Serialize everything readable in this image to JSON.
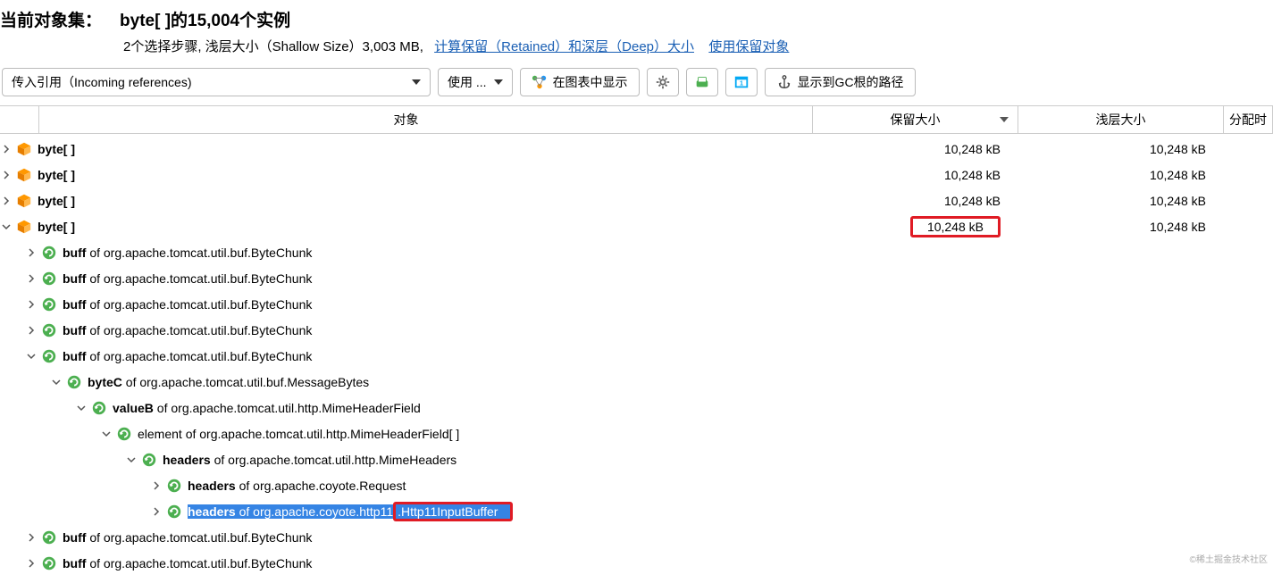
{
  "header": {
    "title_label": "当前对象集：",
    "title_value": "byte[ ]的15,004个实例",
    "subtitle_prefix": "2个选择步骤, 浅层大小（Shallow Size）3,003 MB,",
    "link1": "计算保留（Retained）和深层（Deep）大小",
    "link2": "使用保留对象"
  },
  "toolbar": {
    "incoming_refs": "传入引用（Incoming references)",
    "use_btn": "使用 ...",
    "show_in_graph": "在图表中显示",
    "gc_root_path": "显示到GC根的路径"
  },
  "columns": {
    "object": "对象",
    "retained": "保留大小",
    "shallow": "浅层大小",
    "alloc": "分配时"
  },
  "rows": [
    {
      "depth": 0,
      "exp": "right",
      "icon": "cube",
      "bold": "byte[ ]",
      "rest": "",
      "ret": "10,248 kB",
      "shal": "10,248 kB"
    },
    {
      "depth": 0,
      "exp": "right",
      "icon": "cube",
      "bold": "byte[ ]",
      "rest": "",
      "ret": "10,248 kB",
      "shal": "10,248 kB"
    },
    {
      "depth": 0,
      "exp": "right",
      "icon": "cube",
      "bold": "byte[ ]",
      "rest": "",
      "ret": "10,248 kB",
      "shal": "10,248 kB"
    },
    {
      "depth": 0,
      "exp": "down",
      "icon": "cube",
      "bold": "byte[ ]",
      "rest": "",
      "ret": "10,248 kB",
      "shal": "10,248 kB",
      "ret_boxed": true
    },
    {
      "depth": 1,
      "exp": "right",
      "icon": "ref",
      "bold": "buff",
      "rest": " of org.apache.tomcat.util.buf.ByteChunk"
    },
    {
      "depth": 1,
      "exp": "right",
      "icon": "ref",
      "bold": "buff",
      "rest": " of org.apache.tomcat.util.buf.ByteChunk"
    },
    {
      "depth": 1,
      "exp": "right",
      "icon": "ref",
      "bold": "buff",
      "rest": " of org.apache.tomcat.util.buf.ByteChunk"
    },
    {
      "depth": 1,
      "exp": "right",
      "icon": "ref",
      "bold": "buff",
      "rest": " of org.apache.tomcat.util.buf.ByteChunk"
    },
    {
      "depth": 1,
      "exp": "down",
      "icon": "ref",
      "bold": "buff",
      "rest": " of org.apache.tomcat.util.buf.ByteChunk"
    },
    {
      "depth": 2,
      "exp": "down",
      "icon": "ref",
      "bold": "byteC",
      "rest": " of org.apache.tomcat.util.buf.MessageBytes"
    },
    {
      "depth": 3,
      "exp": "down",
      "icon": "ref",
      "bold": "valueB",
      "rest": " of org.apache.tomcat.util.http.MimeHeaderField"
    },
    {
      "depth": 4,
      "exp": "down",
      "icon": "ref",
      "bold": "",
      "rest": "element of org.apache.tomcat.util.http.MimeHeaderField[ ]"
    },
    {
      "depth": 5,
      "exp": "down",
      "icon": "ref",
      "bold": "headers",
      "rest": " of org.apache.tomcat.util.http.MimeHeaders"
    },
    {
      "depth": 6,
      "exp": "right",
      "icon": "ref",
      "bold": "headers",
      "rest": " of org.apache.coyote.Request"
    },
    {
      "depth": 6,
      "exp": "right",
      "icon": "ref",
      "bold": "headers",
      "rest": " of org.apache.coyote.http11",
      "selected": true,
      "boxed_suffix": ".Http11InputBuffer"
    },
    {
      "depth": 1,
      "exp": "right",
      "icon": "ref",
      "bold": "buff",
      "rest": " of org.apache.tomcat.util.buf.ByteChunk"
    },
    {
      "depth": 1,
      "exp": "right",
      "icon": "ref",
      "bold": "buff",
      "rest": " of org.apache.tomcat.util.buf.ByteChunk"
    }
  ],
  "watermark": "©稀土掘金技术社区"
}
